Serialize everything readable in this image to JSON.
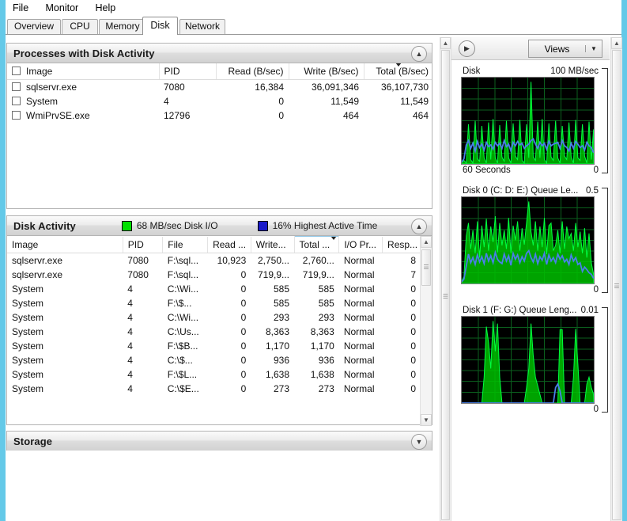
{
  "window": {
    "frame_color": "#64c9e8"
  },
  "menubar": {
    "items": [
      {
        "label": "File"
      },
      {
        "label": "Monitor"
      },
      {
        "label": "Help"
      }
    ]
  },
  "tabs": {
    "active": "Disk",
    "items": [
      {
        "label": "Overview",
        "active": false
      },
      {
        "label": "CPU",
        "active": false
      },
      {
        "label": "Memory",
        "active": false
      },
      {
        "label": "Disk",
        "active": true
      },
      {
        "label": "Network",
        "active": false
      }
    ]
  },
  "processes_panel": {
    "title": "Processes with Disk Activity",
    "collapse_icon": "chevron-up-icon",
    "columns": [
      {
        "label": "Image",
        "align": "left"
      },
      {
        "label": "PID",
        "align": "left"
      },
      {
        "label": "Read (B/sec)",
        "align": "right"
      },
      {
        "label": "Write (B/sec)",
        "align": "right"
      },
      {
        "label": "Total (B/sec)",
        "align": "right",
        "sorted": true
      }
    ],
    "rows": [
      {
        "checked": false,
        "image": "sqlservr.exe",
        "pid": "7080",
        "read": "16,384",
        "write": "36,091,346",
        "total": "36,107,730"
      },
      {
        "checked": false,
        "image": "System",
        "pid": "4",
        "read": "0",
        "write": "11,549",
        "total": "11,549"
      },
      {
        "checked": false,
        "image": "WmiPrvSE.exe",
        "pid": "12796",
        "read": "0",
        "write": "464",
        "total": "464"
      }
    ]
  },
  "disk_activity_panel": {
    "title": "Disk Activity",
    "collapse_icon": "chevron-up-icon",
    "legend": [
      {
        "swatch": "#00e000",
        "text": "68 MB/sec Disk I/O"
      },
      {
        "swatch": "#1a1ac8",
        "text": "16% Highest Active Time"
      }
    ],
    "columns": [
      {
        "label": "Image",
        "align": "left"
      },
      {
        "label": "PID",
        "align": "left"
      },
      {
        "label": "File",
        "align": "left"
      },
      {
        "label": "Read ...",
        "align": "right"
      },
      {
        "label": "Write...",
        "align": "right"
      },
      {
        "label": "Total ...",
        "align": "right",
        "sorted": true
      },
      {
        "label": "I/O Pr...",
        "align": "left"
      },
      {
        "label": "Resp...",
        "align": "right"
      }
    ],
    "rows": [
      {
        "image": "sqlservr.exe",
        "pid": "7080",
        "file": "F:\\sql...",
        "read": "10,923",
        "write": "2,750...",
        "total": "2,760...",
        "iopri": "Normal",
        "resp": "8"
      },
      {
        "image": "sqlservr.exe",
        "pid": "7080",
        "file": "F:\\sql...",
        "read": "0",
        "write": "719,9...",
        "total": "719,9...",
        "iopri": "Normal",
        "resp": "7"
      },
      {
        "image": "System",
        "pid": "4",
        "file": "C:\\Wi...",
        "read": "0",
        "write": "585",
        "total": "585",
        "iopri": "Normal",
        "resp": "0"
      },
      {
        "image": "System",
        "pid": "4",
        "file": "F:\\$...",
        "read": "0",
        "write": "585",
        "total": "585",
        "iopri": "Normal",
        "resp": "0"
      },
      {
        "image": "System",
        "pid": "4",
        "file": "C:\\Wi...",
        "read": "0",
        "write": "293",
        "total": "293",
        "iopri": "Normal",
        "resp": "0"
      },
      {
        "image": "System",
        "pid": "4",
        "file": "C:\\Us...",
        "read": "0",
        "write": "8,363",
        "total": "8,363",
        "iopri": "Normal",
        "resp": "0"
      },
      {
        "image": "System",
        "pid": "4",
        "file": "F:\\$B...",
        "read": "0",
        "write": "1,170",
        "total": "1,170",
        "iopri": "Normal",
        "resp": "0"
      },
      {
        "image": "System",
        "pid": "4",
        "file": "C:\\$...",
        "read": "0",
        "write": "936",
        "total": "936",
        "iopri": "Normal",
        "resp": "0"
      },
      {
        "image": "System",
        "pid": "4",
        "file": "F:\\$L...",
        "read": "0",
        "write": "1,638",
        "total": "1,638",
        "iopri": "Normal",
        "resp": "0"
      },
      {
        "image": "System",
        "pid": "4",
        "file": "C:\\$E...",
        "read": "0",
        "write": "273",
        "total": "273",
        "iopri": "Normal",
        "resp": "0"
      }
    ]
  },
  "storage_panel": {
    "title": "Storage",
    "collapse_icon": "chevron-down-icon"
  },
  "views_bar": {
    "expand_icon": "chevron-right-circle-icon",
    "views_label": "Views",
    "dropdown_icon": "caret-down-icon"
  },
  "chart_data": [
    {
      "type": "area",
      "name": "disk-throughput-graph",
      "title": "Disk",
      "scale_label": "100 MB/sec",
      "xlabel": "60 Seconds",
      "ymin_label": "0",
      "ylim": [
        0,
        100
      ],
      "grid": true,
      "bg": "#000000",
      "grid_color": "#0b5f1e",
      "series": [
        {
          "name": "Disk I/O",
          "color": "#00e000",
          "values": [
            2,
            4,
            3,
            46,
            5,
            3,
            50,
            6,
            4,
            44,
            7,
            3,
            48,
            5,
            52,
            6,
            3,
            45,
            8,
            4,
            50,
            6,
            3,
            47,
            9,
            5,
            51,
            4,
            3,
            46,
            7,
            95,
            8,
            4,
            49,
            6,
            52,
            5,
            3,
            47,
            8,
            4,
            50,
            6,
            3,
            44,
            9,
            5,
            48,
            7,
            3,
            51,
            6,
            4,
            46,
            8,
            3,
            49,
            5,
            40
          ]
        },
        {
          "name": "Highest Active Time",
          "color": "#3c6ee0",
          "values": [
            1,
            6,
            22,
            27,
            18,
            24,
            15,
            26,
            19,
            23,
            16,
            25,
            20,
            22,
            17,
            26,
            21,
            24,
            18,
            27,
            19,
            23,
            16,
            25,
            20,
            26,
            17,
            24,
            19,
            22,
            21,
            27,
            29,
            23,
            18,
            25,
            20,
            24,
            17,
            26,
            19,
            23,
            21,
            25,
            18,
            27,
            20,
            22,
            16,
            24,
            19,
            26,
            21,
            23,
            17,
            25,
            20,
            22,
            14,
            8
          ]
        }
      ]
    },
    {
      "type": "area",
      "name": "disk0-queue-length-graph",
      "title": "Disk 0 (C: D: E:) Queue Le...",
      "scale_label": "0.5",
      "ymin_label": "0",
      "ylim": [
        0,
        0.5
      ],
      "grid": true,
      "bg": "#000000",
      "grid_color": "#0b5f1e",
      "series": [
        {
          "name": "Queue Length",
          "color": "#00e000",
          "values": [
            3,
            8,
            55,
            70,
            40,
            62,
            35,
            72,
            30,
            68,
            42,
            75,
            38,
            66,
            48,
            78,
            36,
            70,
            44,
            62,
            40,
            74,
            35,
            68,
            50,
            72,
            38,
            64,
            46,
            70,
            95,
            60,
            44,
            72,
            38,
            66,
            42,
            76,
            34,
            68,
            48,
            70,
            36,
            62,
            44,
            74,
            40,
            66,
            52,
            58,
            38,
            70,
            42,
            60,
            34,
            64,
            30,
            56,
            24,
            14
          ]
        },
        {
          "name": "Highest Active Time",
          "color": "#3c6ee0",
          "values": [
            2,
            5,
            20,
            34,
            24,
            30,
            22,
            33,
            25,
            31,
            23,
            35,
            26,
            32,
            24,
            36,
            27,
            30,
            23,
            34,
            25,
            32,
            21,
            35,
            28,
            33,
            24,
            31,
            26,
            35,
            38,
            30,
            25,
            34,
            23,
            31,
            27,
            36,
            22,
            33,
            26,
            32,
            24,
            30,
            28,
            35,
            25,
            31,
            29,
            28,
            22,
            33,
            26,
            30,
            21,
            32,
            20,
            26,
            14,
            6
          ]
        }
      ]
    },
    {
      "type": "area",
      "name": "disk1-queue-length-graph",
      "title": "Disk 1 (F: G:) Queue Leng...",
      "scale_label": "0.01",
      "ymin_label": "0",
      "ylim": [
        0,
        0.01
      ],
      "grid": true,
      "bg": "#000000",
      "grid_color": "#0b5f1e",
      "series": [
        {
          "name": "Queue Length",
          "color": "#00e000",
          "values": [
            0,
            0,
            0,
            0,
            0,
            0,
            0,
            0,
            0,
            0,
            30,
            88,
            70,
            40,
            95,
            60,
            92,
            30,
            0,
            0,
            0,
            0,
            0,
            0,
            0,
            0,
            0,
            0,
            0,
            18,
            40,
            92,
            55,
            30,
            20,
            10,
            0,
            0,
            0,
            0,
            0,
            0,
            0,
            0,
            85,
            85,
            0,
            0,
            0,
            0,
            30,
            86,
            45,
            0,
            0,
            0,
            22,
            30,
            18,
            10
          ]
        },
        {
          "name": "Highest Active Time",
          "color": "#3c6ee0",
          "values": [
            0,
            0,
            0,
            0,
            0,
            0,
            0,
            0,
            0,
            0,
            0,
            0,
            0,
            0,
            0,
            0,
            0,
            0,
            0,
            0,
            0,
            0,
            0,
            0,
            0,
            0,
            0,
            0,
            0,
            0,
            0,
            0,
            0,
            0,
            0,
            0,
            0,
            0,
            0,
            0,
            0,
            0,
            0,
            18,
            22,
            14,
            0,
            0,
            0,
            0,
            0,
            0,
            0,
            0,
            0,
            0,
            0,
            0,
            0,
            0
          ]
        }
      ]
    }
  ]
}
